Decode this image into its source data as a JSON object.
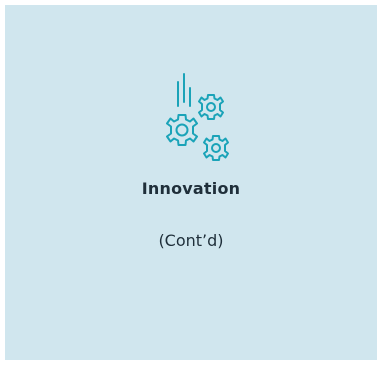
{
  "card": {
    "icon": "gears-icon",
    "title": "Innovation",
    "subtitle": "(Cont’d)",
    "background_color": "#d0e6ee",
    "icon_color": "#1aa3b8"
  }
}
